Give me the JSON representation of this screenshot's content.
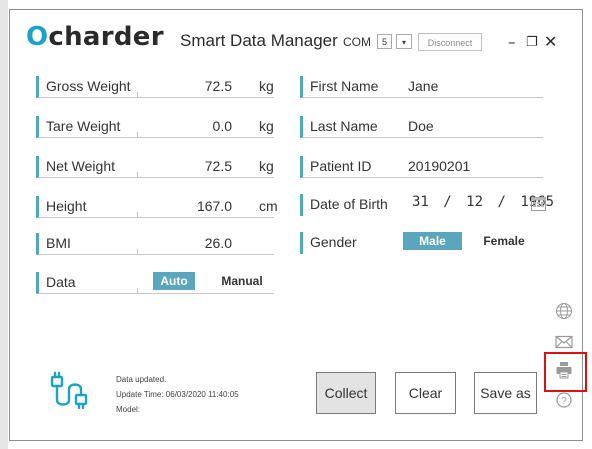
{
  "header": {
    "logo_text": "charder",
    "app_title": "Smart Data Manager",
    "com_label": "COM",
    "com_value": "5",
    "disconnect_label": "Disconnect"
  },
  "measurements": [
    {
      "label": "Gross Weight",
      "value": "72.5",
      "unit": "kg"
    },
    {
      "label": "Tare Weight",
      "value": "0.0",
      "unit": "kg"
    },
    {
      "label": "Net Weight",
      "value": "72.5",
      "unit": "kg"
    },
    {
      "label": "Height",
      "value": "167.0",
      "unit": "cm"
    },
    {
      "label": "BMI",
      "value": "26.0",
      "unit": ""
    }
  ],
  "data_mode": {
    "label": "Data",
    "options": [
      "Auto",
      "Manual"
    ],
    "selected": "Auto"
  },
  "patient": {
    "first_name_label": "First Name",
    "first_name": "Jane",
    "last_name_label": "Last Name",
    "last_name": "Doe",
    "patient_id_label": "Patient ID",
    "patient_id": "20190201",
    "dob_label": "Date of Birth",
    "dob_day": "31",
    "dob_month": "12",
    "dob_year": "1965",
    "dob_separator": "/",
    "gender_label": "Gender",
    "gender_options": [
      "Male",
      "Female"
    ],
    "gender_selected": "Male"
  },
  "status": {
    "line1": "Data updated.",
    "line2": "Update Time: 06/03/2020 11:40:05",
    "line3": "Model:"
  },
  "actions": {
    "collect_label": "Collect",
    "clear_label": "Clear",
    "save_label": "Save as"
  },
  "side_icons": [
    "globe-icon",
    "mail-icon",
    "printer-icon",
    "help-icon"
  ],
  "colors": {
    "accent": "#5aa6bc",
    "logo_o": "#1aa2c8",
    "highlight": "#e01010"
  }
}
